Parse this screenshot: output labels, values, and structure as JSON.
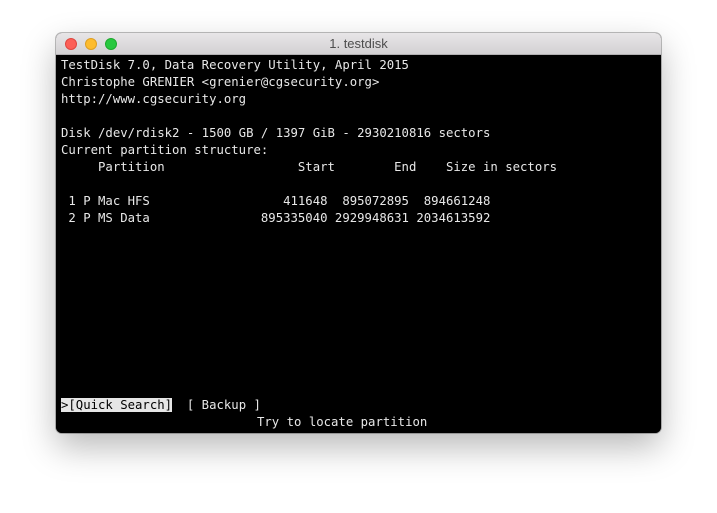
{
  "window": {
    "title": "1. testdisk"
  },
  "header": {
    "line1": "TestDisk 7.0, Data Recovery Utility, April 2015",
    "line2": "Christophe GRENIER <grenier@cgsecurity.org>",
    "line3": "http://www.cgsecurity.org"
  },
  "disk": {
    "info": "Disk /dev/rdisk2 - 1500 GB / 1397 GiB - 2930210816 sectors",
    "structure_label": "Current partition structure:",
    "columns_header": "     Partition                  Start        End    Size in sectors"
  },
  "partitions": [
    " 1 P Mac HFS                  411648  895072895  894661248",
    " 2 P MS Data               895335040 2929948631 2034613592"
  ],
  "menu": {
    "quick_search": ">[Quick Search]",
    "backup": "[ Backup ]",
    "hint": "Try to locate partition"
  }
}
